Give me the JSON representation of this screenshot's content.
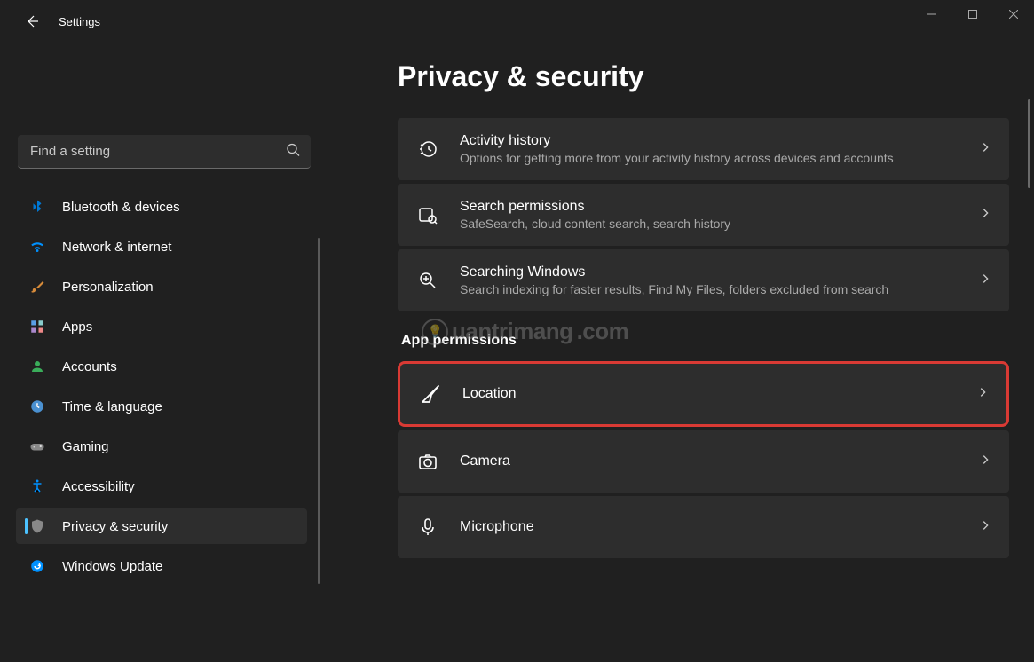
{
  "app": {
    "title": "Settings"
  },
  "search": {
    "placeholder": "Find a setting"
  },
  "sidebar": {
    "items": [
      {
        "label": "Bluetooth & devices",
        "icon": "bluetooth",
        "name": "sidebar-item-bluetooth-devices"
      },
      {
        "label": "Network & internet",
        "icon": "wifi",
        "name": "sidebar-item-network-internet"
      },
      {
        "label": "Personalization",
        "icon": "brush",
        "name": "sidebar-item-personalization"
      },
      {
        "label": "Apps",
        "icon": "apps",
        "name": "sidebar-item-apps"
      },
      {
        "label": "Accounts",
        "icon": "account",
        "name": "sidebar-item-accounts"
      },
      {
        "label": "Time & language",
        "icon": "time",
        "name": "sidebar-item-time-language"
      },
      {
        "label": "Gaming",
        "icon": "gaming",
        "name": "sidebar-item-gaming"
      },
      {
        "label": "Accessibility",
        "icon": "accessibility",
        "name": "sidebar-item-accessibility"
      },
      {
        "label": "Privacy & security",
        "icon": "privacy",
        "name": "sidebar-item-privacy-security",
        "active": true
      },
      {
        "label": "Windows Update",
        "icon": "update",
        "name": "sidebar-item-windows-update"
      }
    ]
  },
  "main": {
    "title": "Privacy & security",
    "sectionHeader": "App permissions",
    "cards1": [
      {
        "title": "Activity history",
        "sub": "Options for getting more from your activity history across devices and accounts",
        "icon": "history",
        "name": "card-activity-history"
      },
      {
        "title": "Search permissions",
        "sub": "SafeSearch, cloud content search, search history",
        "icon": "search-perm",
        "name": "card-search-permissions"
      },
      {
        "title": "Searching Windows",
        "sub": "Search indexing for faster results, Find My Files, folders excluded from search",
        "icon": "search-win",
        "name": "card-searching-windows"
      }
    ],
    "cards2": [
      {
        "title": "Location",
        "icon": "location",
        "name": "card-location",
        "highlighted": true
      },
      {
        "title": "Camera",
        "icon": "camera",
        "name": "card-camera"
      },
      {
        "title": "Microphone",
        "icon": "microphone",
        "name": "card-microphone"
      }
    ]
  },
  "watermark": "uantrimang"
}
